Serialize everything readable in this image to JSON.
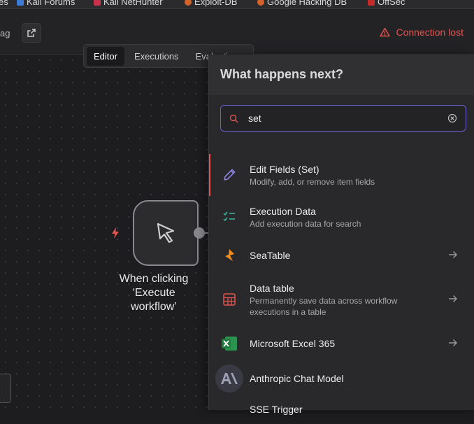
{
  "bookmarks": [
    {
      "label": "es",
      "icon": "none"
    },
    {
      "label": "Kali Forums",
      "icon": "kali-icon"
    },
    {
      "label": "Kali NetHunter",
      "icon": "kali-icon"
    },
    {
      "label": "Exploit-DB",
      "icon": "exploit-db-icon"
    },
    {
      "label": "Google Hacking DB",
      "icon": "ghdb-icon"
    },
    {
      "label": "OffSec",
      "icon": "offsec-icon"
    }
  ],
  "header": {
    "tag_text": "ag",
    "connection_status": "Connection lost",
    "status_color": "#e2544f"
  },
  "tabs": [
    {
      "label": "Editor",
      "active": true
    },
    {
      "label": "Executions",
      "active": false
    },
    {
      "label": "Evaluations",
      "active": false
    }
  ],
  "node": {
    "label": "When clicking ‘Execute\nworkflow’"
  },
  "panel": {
    "title": "What happens next?",
    "search_value": "set",
    "items": [
      {
        "name": "Edit Fields (Set)",
        "desc": "Modify, add, or remove item fields",
        "icon": "pencil-icon",
        "arrow": false,
        "selected": true
      },
      {
        "name": "Execution Data",
        "desc": "Add execution data for search",
        "icon": "checklist-icon",
        "arrow": false,
        "selected": false
      },
      {
        "name": "SeaTable",
        "desc": "",
        "icon": "seatable-icon",
        "arrow": true,
        "selected": false
      },
      {
        "name": "Data table",
        "desc": "Permanently save data across workflow executions in a table",
        "icon": "table-icon",
        "arrow": true,
        "selected": false
      },
      {
        "name": "Microsoft Excel 365",
        "desc": "",
        "icon": "excel-icon",
        "arrow": true,
        "selected": false
      },
      {
        "name": "Anthropic Chat Model",
        "desc": "",
        "icon": "anthropic-icon",
        "arrow": false,
        "selected": false
      },
      {
        "name": "SSE Trigger",
        "desc": "",
        "icon": "sse-icon",
        "arrow": false,
        "selected": false
      }
    ]
  },
  "colors": {
    "accent": "#6b5fd6",
    "error": "#e2544f",
    "excel_green": "#1f7a3c",
    "seatable_orange": "#f28c1e"
  }
}
